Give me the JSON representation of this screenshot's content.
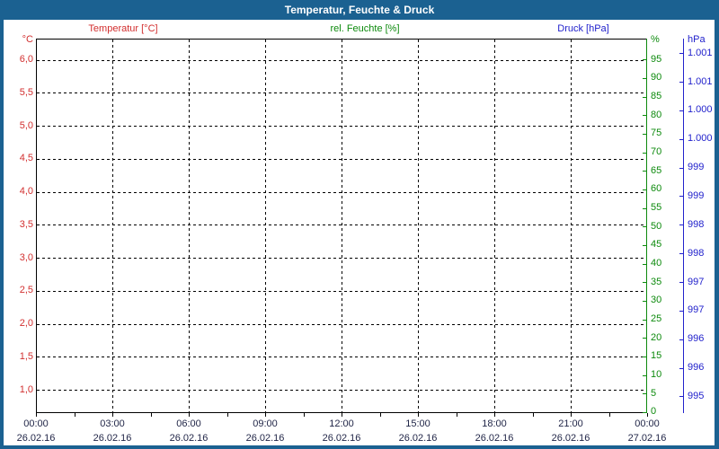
{
  "window": {
    "title": "Temperatur, Feuchte & Druck"
  },
  "legend": {
    "temperature": "Temperatur [°C]",
    "humidity": "rel. Feuchte [%]",
    "pressure": "Druck [hPa]"
  },
  "colors": {
    "frame": "#1b6191",
    "temperature": "#d22f2f",
    "humidity": "#0d8a0d",
    "pressure": "#2222cc",
    "datetime_text": "#1e2345",
    "grid": "#000000",
    "background": "#ffffff"
  },
  "axes": {
    "temperature": {
      "unit": "°C",
      "tick_labels": [
        "6,0",
        "5,5",
        "5,0",
        "4,5",
        "4,0",
        "3,5",
        "3,0",
        "2,5",
        "2,0",
        "1,5",
        "1,0"
      ]
    },
    "humidity": {
      "unit": "%",
      "tick_labels": [
        "95",
        "90",
        "85",
        "80",
        "75",
        "70",
        "65",
        "60",
        "55",
        "50",
        "45",
        "40",
        "35",
        "30",
        "25",
        "20",
        "15",
        "10",
        "5",
        "0"
      ]
    },
    "pressure": {
      "unit": "hPa",
      "tick_labels": [
        "1.001",
        "1.001",
        "1.000",
        "1.000",
        "999",
        "999",
        "998",
        "998",
        "997",
        "997",
        "996",
        "996",
        "995"
      ]
    }
  },
  "x_axis": {
    "times": [
      "00:00",
      "03:00",
      "06:00",
      "09:00",
      "12:00",
      "15:00",
      "18:00",
      "21:00",
      "00:00"
    ],
    "dates": [
      "26.02.16",
      "26.02.16",
      "26.02.16",
      "26.02.16",
      "26.02.16",
      "26.02.16",
      "26.02.16",
      "26.02.16",
      "27.02.16"
    ]
  },
  "chart_data": {
    "type": "line",
    "title": "Temperatur, Feuchte & Druck",
    "x_range": [
      "26.02.16 00:00",
      "27.02.16 00:00"
    ],
    "x_major_tick_hours": 3,
    "x_minor_tick_hours": 1.5,
    "grid": true,
    "series": [
      {
        "name": "Temperatur [°C]",
        "color": "#d22f2f",
        "axis": "temperature",
        "values": []
      },
      {
        "name": "rel. Feuchte [%]",
        "color": "#0d8a0d",
        "axis": "humidity",
        "values": []
      },
      {
        "name": "Druck [hPa]",
        "color": "#2222cc",
        "axis": "pressure",
        "values": []
      }
    ],
    "axis_ranges": {
      "temperature": [
        0.65,
        6.32
      ],
      "humidity": [
        0,
        100.6
      ],
      "pressure": [
        994.7,
        1001.25
      ]
    },
    "pressure_tick_step_hpa": 0.5
  }
}
